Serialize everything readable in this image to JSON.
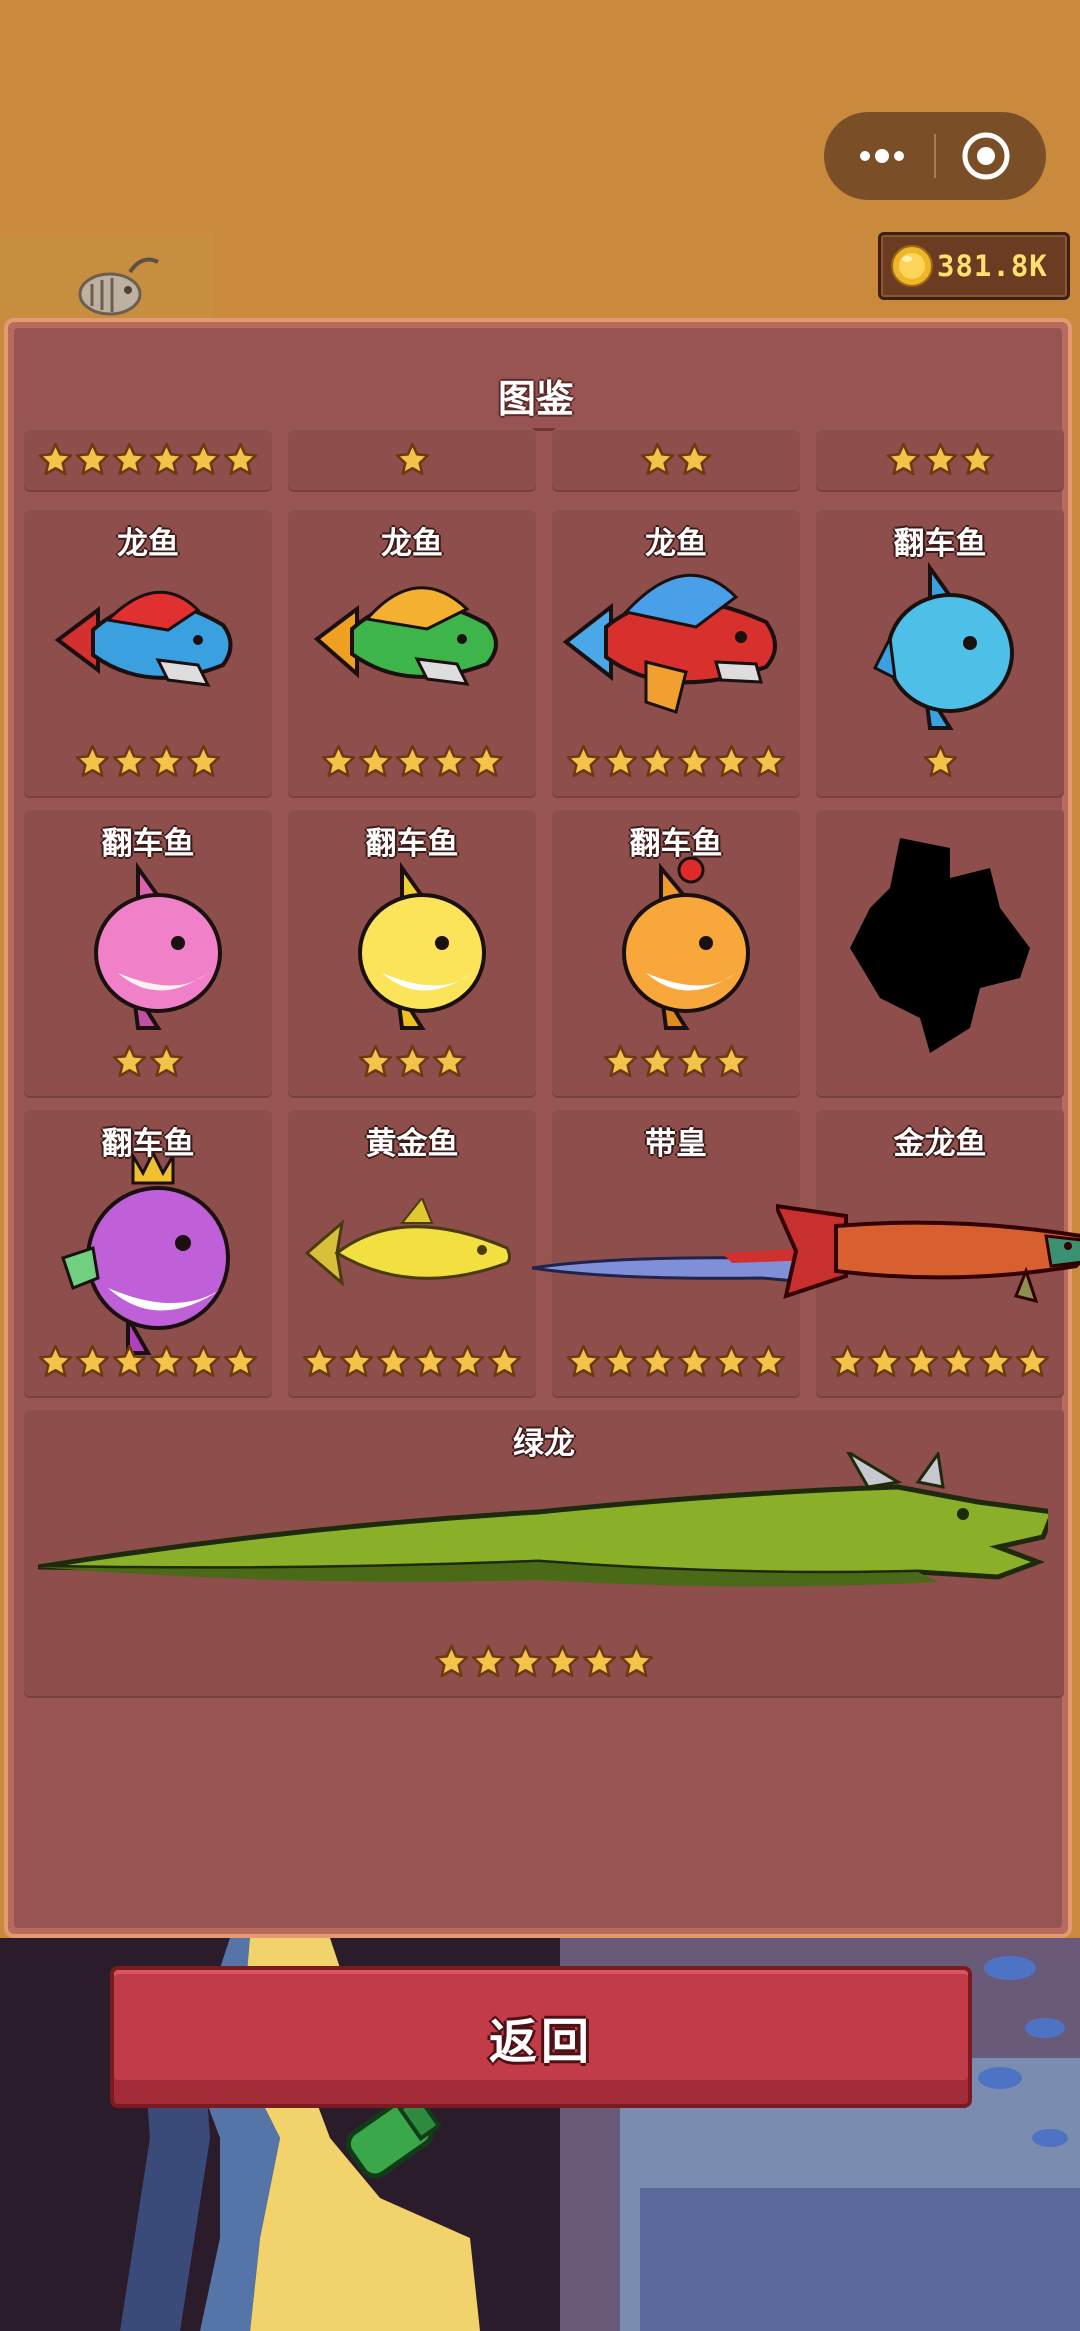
{
  "header": {
    "coins": "381.8K"
  },
  "panel": {
    "title": "图鉴",
    "rows": [
      [
        {
          "name": "",
          "stars": 6
        },
        {
          "name": "",
          "stars": 1
        },
        {
          "name": "",
          "stars": 2
        },
        {
          "name": "",
          "stars": 3
        }
      ],
      [
        {
          "name": "龙鱼",
          "stars": 4,
          "art": "dragon-fish-red-blue"
        },
        {
          "name": "龙鱼",
          "stars": 5,
          "art": "dragon-fish-orange-green"
        },
        {
          "name": "龙鱼",
          "stars": 6,
          "art": "dragon-fish-blue-red"
        },
        {
          "name": "翻车鱼",
          "stars": 1,
          "art": "sunfish-blue"
        }
      ],
      [
        {
          "name": "翻车鱼",
          "stars": 2,
          "art": "sunfish-pink"
        },
        {
          "name": "翻车鱼",
          "stars": 3,
          "art": "sunfish-yellow"
        },
        {
          "name": "翻车鱼",
          "stars": 4,
          "art": "sunfish-orange"
        },
        {
          "name": "",
          "stars": 0,
          "art": "locked-silhouette"
        }
      ],
      [
        {
          "name": "翻车鱼",
          "stars": 6,
          "art": "sunfish-purple-crown"
        },
        {
          "name": "黄金鱼",
          "stars": 6,
          "art": "golden-tuna"
        },
        {
          "name": "带皇",
          "stars": 6,
          "art": "oarfish"
        },
        {
          "name": "金龙鱼",
          "stars": 6,
          "art": "arowana"
        }
      ]
    ],
    "wide": {
      "name": "绿龙",
      "stars": 6,
      "art": "green-dragon"
    }
  },
  "footer": {
    "return_label": "返回"
  },
  "colors": {
    "background": "#c98a3e",
    "panel": "#975451",
    "cell": "#8e4e4b",
    "button": "#c23b49",
    "star": "#f5c24a"
  }
}
